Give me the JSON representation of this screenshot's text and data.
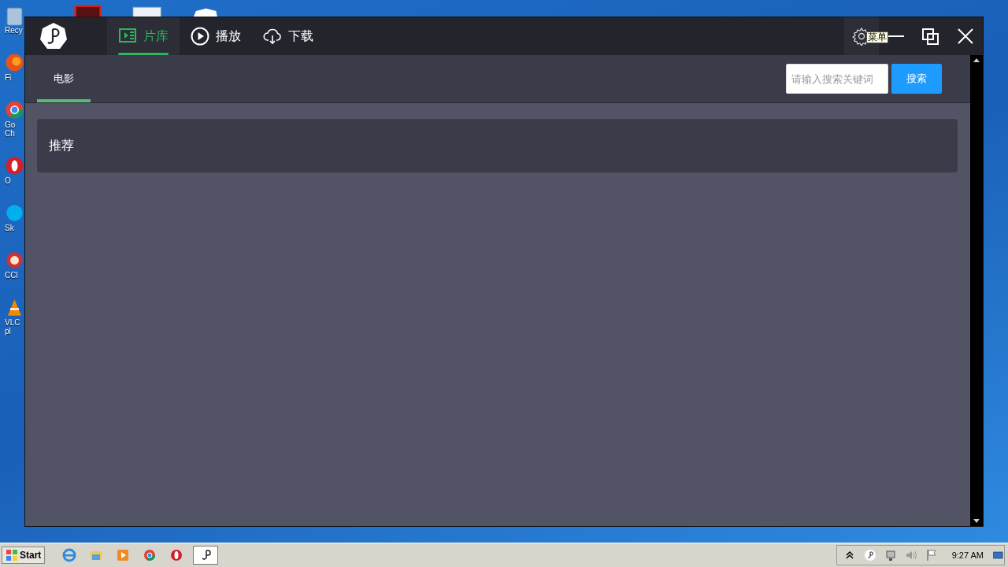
{
  "desktop": {
    "icons": [
      {
        "kind": "recycle",
        "lines": [
          "Recy"
        ]
      },
      {
        "kind": "firefox",
        "lines": [
          "Fi"
        ]
      },
      {
        "kind": "chrome",
        "lines": [
          "Go",
          "Ch"
        ]
      },
      {
        "kind": "opera",
        "lines": [
          "O"
        ]
      },
      {
        "kind": "skype",
        "lines": [
          "Sk"
        ]
      },
      {
        "kind": "ccleaner",
        "lines": [
          "CCl"
        ]
      },
      {
        "kind": "vlc",
        "lines": [
          "VLC",
          "pl"
        ]
      }
    ]
  },
  "window": {
    "nav_tabs": [
      {
        "kind": "library",
        "label": "片库",
        "selected": true
      },
      {
        "kind": "play",
        "label": "播放",
        "selected": false
      },
      {
        "kind": "download",
        "label": "下载",
        "selected": false
      }
    ],
    "tooltip": "菜单",
    "sub_tabs": [
      {
        "label": "电影",
        "selected": true
      }
    ],
    "search": {
      "placeholder": "请输入搜索关键词",
      "button": "搜索"
    },
    "sections": [
      {
        "title": "推荐"
      }
    ]
  },
  "taskbar": {
    "start": "Start",
    "apps": [
      {
        "kind": "ie",
        "active": false
      },
      {
        "kind": "folder",
        "active": false
      },
      {
        "kind": "media",
        "active": false
      },
      {
        "kind": "chrome",
        "active": false
      },
      {
        "kind": "opera",
        "active": false
      },
      {
        "kind": "app",
        "active": true
      }
    ],
    "clock": "9:27 AM"
  }
}
